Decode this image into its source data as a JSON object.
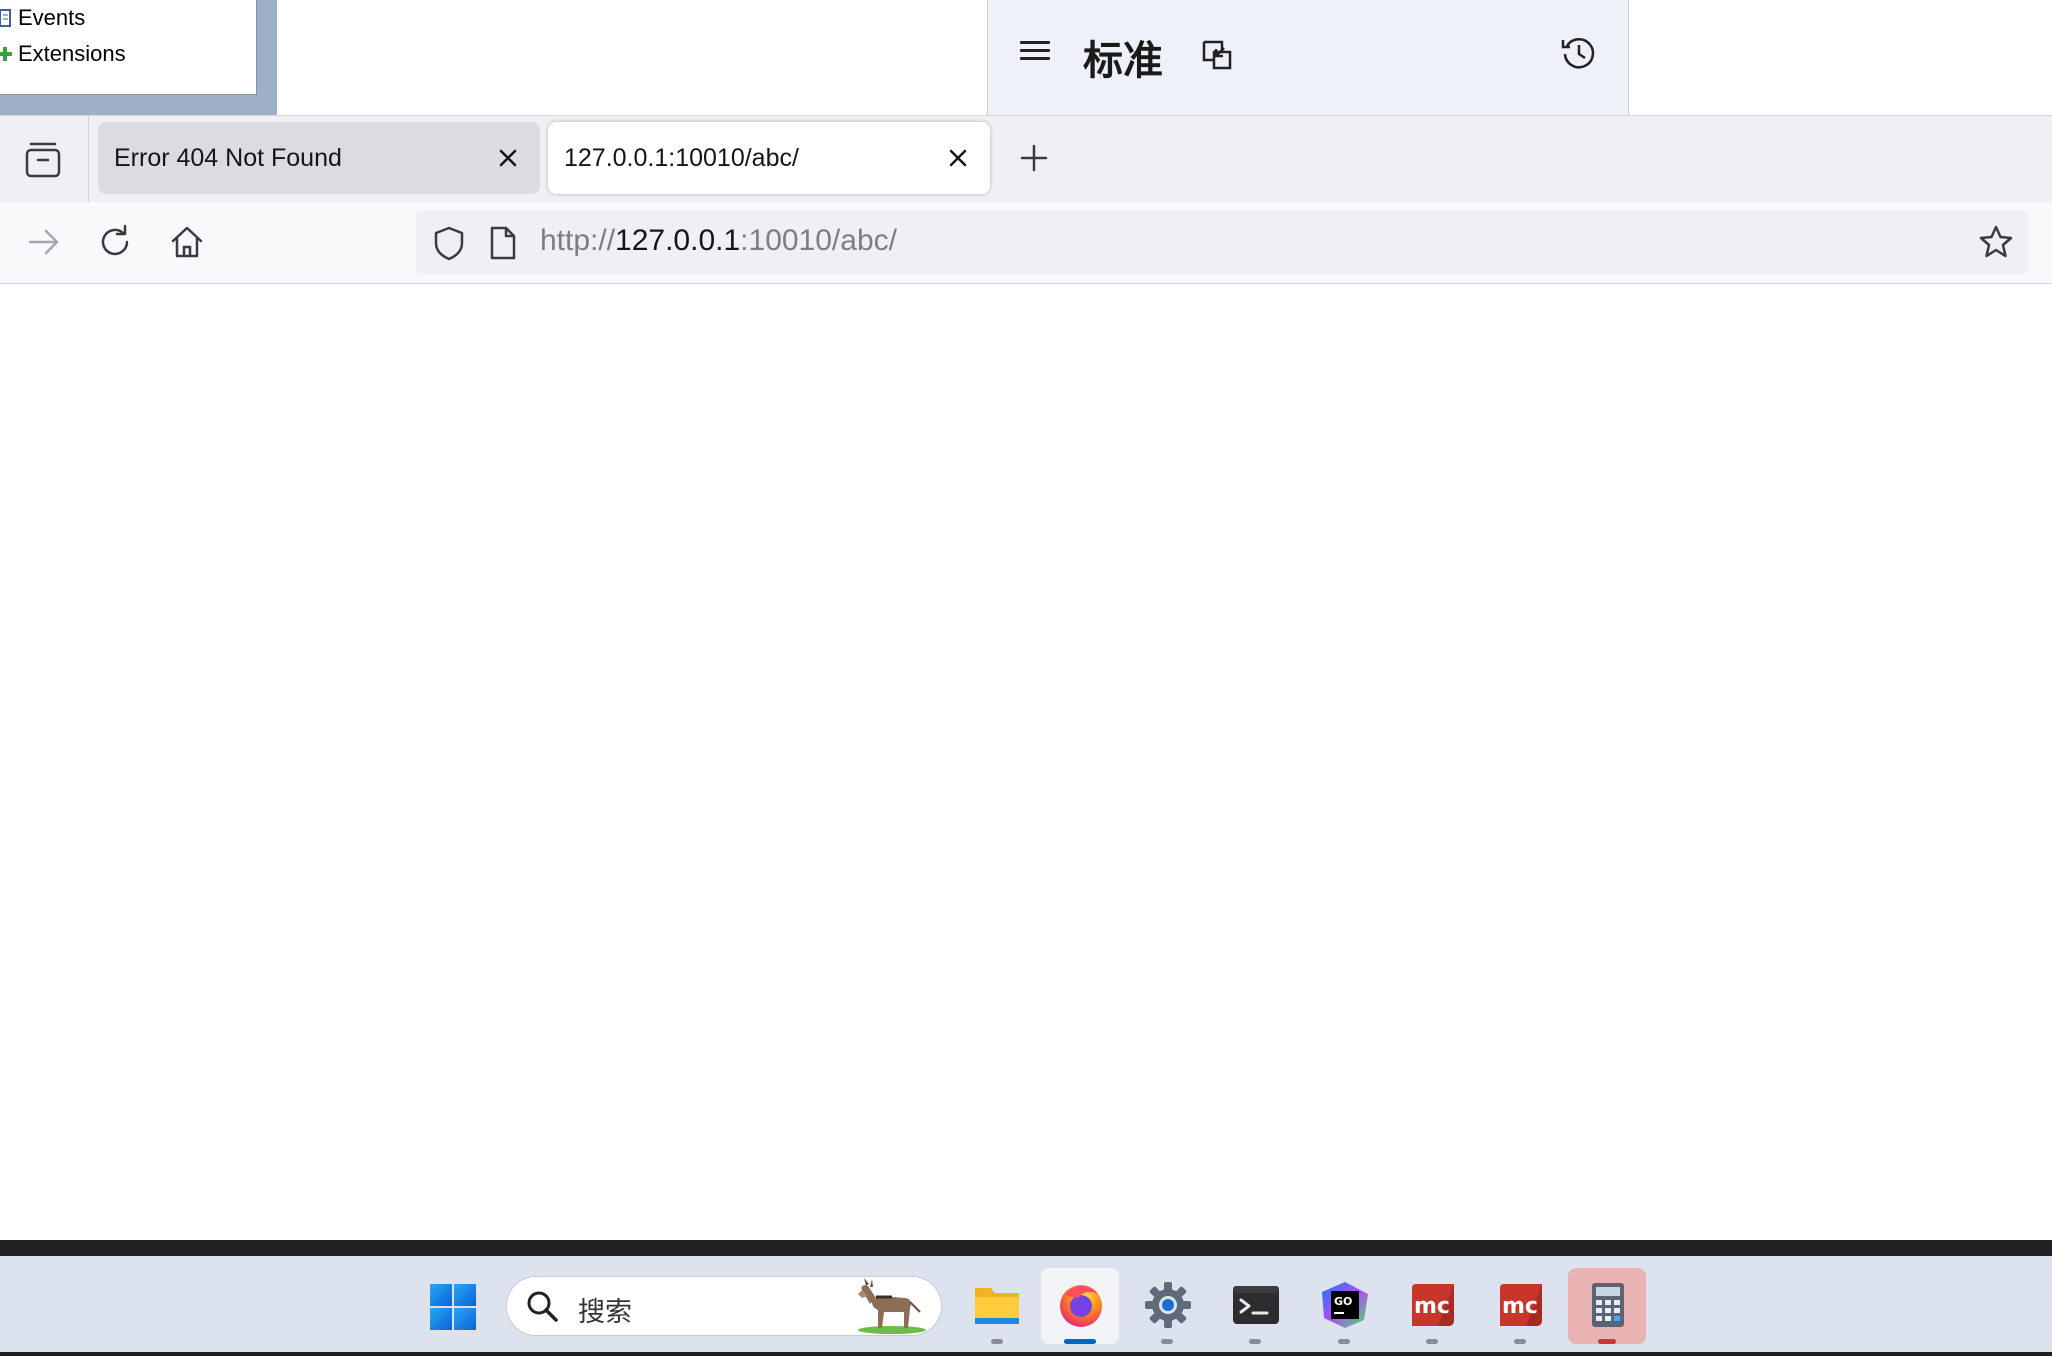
{
  "background_windows": {
    "tree_items": [
      {
        "label": "Events"
      },
      {
        "label": "Extensions"
      }
    ],
    "calculator": {
      "mode_title": "标准"
    }
  },
  "browser": {
    "tabs": [
      {
        "label": "Error 404 Not Found",
        "active": false
      },
      {
        "label": "127.0.0.1:10010/abc/",
        "active": true
      }
    ],
    "url": {
      "scheme": "http://",
      "host": "127.0.0.1",
      "rest": ":10010/abc/"
    }
  },
  "taskbar": {
    "search_placeholder": "搜索",
    "apps": [
      {
        "name": "file-explorer",
        "running": true
      },
      {
        "name": "firefox",
        "running": true,
        "focused": true
      },
      {
        "name": "settings",
        "running": true
      },
      {
        "name": "terminal",
        "running": true
      },
      {
        "name": "goland",
        "running": true
      },
      {
        "name": "mc",
        "running": true
      },
      {
        "name": "mc",
        "running": true
      },
      {
        "name": "calculator",
        "running": true,
        "focused": true
      }
    ],
    "colors": {
      "active_indicator": "#0067c0",
      "calc_indicator": "#d13438"
    }
  }
}
